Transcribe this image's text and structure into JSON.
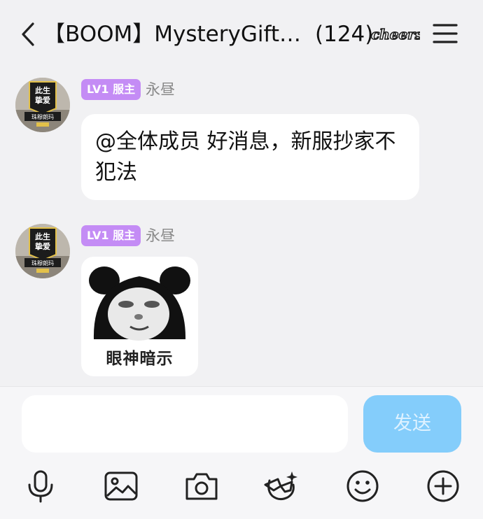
{
  "header": {
    "title": "【BOOM】MysteryGift…",
    "member_count": "(124)",
    "emblem_text": "cheers",
    "back_icon": "chevron-left-icon",
    "menu_icon": "hamburger-menu-icon"
  },
  "messages": [
    {
      "level_badge": "LV1 服主",
      "sender": "永昼",
      "type": "text",
      "text": "@全体成员 好消息，新服抄家不犯法",
      "avatar_text": [
        "此生",
        "挚爱",
        "珠穆朗玛"
      ]
    },
    {
      "level_badge": "LV1 服主",
      "sender": "永昼",
      "type": "sticker",
      "sticker_caption": "眼神暗示",
      "avatar_text": [
        "此生",
        "挚爱",
        "珠穆朗玛"
      ]
    }
  ],
  "input": {
    "placeholder": "",
    "value": "",
    "send_label": "发送"
  },
  "toolbar": [
    "microphone-icon",
    "image-icon",
    "camera-icon",
    "sunglasses-sticker-icon",
    "emoji-icon",
    "plus-icon"
  ],
  "colors": {
    "background": "#f1f1f3",
    "badge": "#c48cf5",
    "send_button": "#84cdfb",
    "bubble": "#ffffff"
  }
}
